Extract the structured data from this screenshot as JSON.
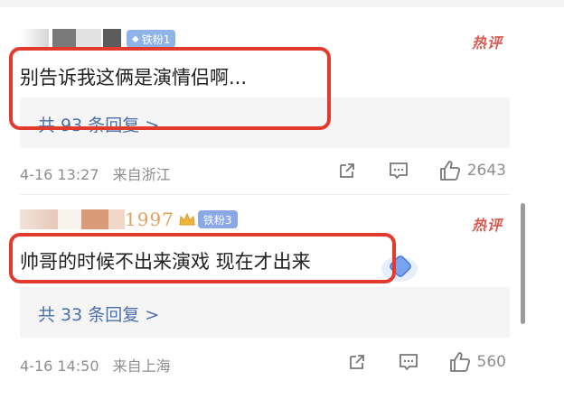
{
  "comments": [
    {
      "badge": "铁粉1",
      "hot_label": "热评",
      "text": "别告诉我这俩是演情侣啊...",
      "reply_label": "共 93 条回复 >",
      "date": "4-16 13:27",
      "location": "来自浙江",
      "like_count": "2643"
    },
    {
      "name_fragment": "1997",
      "badge": "铁粉3",
      "hot_label": "热评",
      "text": "帅哥的时候不出来演戏 现在才出来",
      "reply_label": "共 33 条回复 >",
      "date": "4-16 14:50",
      "location": "来自上海",
      "like_count": "560"
    }
  ],
  "colors": {
    "highlight": "#e23b2e",
    "hot": "#d85a4f",
    "reply_link": "#4a6fae",
    "badge1": "#8db3e8",
    "badge3": "#8aa7e6"
  },
  "icons": [
    "share-icon",
    "comment-icon",
    "like-icon",
    "gem-icon",
    "crown-icon"
  ]
}
